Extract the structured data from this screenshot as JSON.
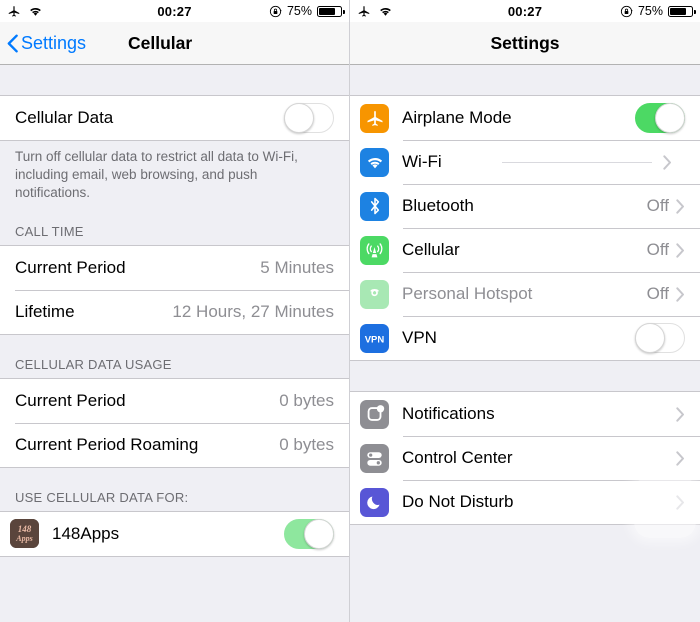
{
  "left": {
    "status_bar": {
      "airplane_icon": "airplane-icon",
      "wifi_icon": "wifi-icon",
      "time": "00:27",
      "rotation_lock_icon": "rotation-lock-icon",
      "battery_percent": "75%",
      "battery_level": 75
    },
    "nav": {
      "back_label": "Settings",
      "title": "Cellular",
      "back_icon": "chevron-left-icon"
    },
    "cellular_data": {
      "label": "Cellular Data",
      "toggle_state": "off",
      "footnote": "Turn off cellular data to restrict all data to Wi-Fi, including email, web browsing, and push notifications."
    },
    "call_time": {
      "header": "CALL TIME",
      "rows": [
        {
          "label": "Current Period",
          "value": "5 Minutes"
        },
        {
          "label": "Lifetime",
          "value": "12 Hours, 27 Minutes"
        }
      ]
    },
    "data_usage": {
      "header": "CELLULAR DATA USAGE",
      "rows": [
        {
          "label": "Current Period",
          "value": "0 bytes"
        },
        {
          "label": "Current Period Roaming",
          "value": "0 bytes"
        }
      ]
    },
    "use_data_for": {
      "header": "USE CELLULAR DATA FOR:",
      "rows": [
        {
          "label": "148Apps",
          "toggle_state": "on",
          "icon": "app-148apps-icon"
        }
      ]
    }
  },
  "right": {
    "status_bar": {
      "airplane_icon": "airplane-icon",
      "wifi_icon": "wifi-icon",
      "time": "00:27",
      "rotation_lock_icon": "rotation-lock-icon",
      "battery_percent": "75%",
      "battery_level": 75
    },
    "nav": {
      "title": "Settings"
    },
    "group_one": [
      {
        "label": "Airplane Mode",
        "icon": "airplane-icon",
        "icon_color": "#f79500",
        "control": "toggle",
        "toggle_state": "on",
        "value": "",
        "disabled": false
      },
      {
        "label": "Wi-Fi",
        "icon": "wifi-icon",
        "icon_color": "#1d82e2",
        "control": "chevron",
        "value": "",
        "dash": true,
        "disabled": false
      },
      {
        "label": "Bluetooth",
        "icon": "bluetooth-icon",
        "icon_color": "#1d82e2",
        "control": "chevron",
        "value": "Off",
        "disabled": false
      },
      {
        "label": "Cellular",
        "icon": "cellular-antenna-icon",
        "icon_color": "#4cd964",
        "control": "chevron",
        "value": "Off",
        "disabled": false
      },
      {
        "label": "Personal Hotspot",
        "icon": "personal-hotspot-icon",
        "icon_color": "#a8e8b4",
        "control": "chevron",
        "value": "Off",
        "disabled": true
      },
      {
        "label": "VPN",
        "icon": "vpn-icon",
        "icon_color": "#1d6fe0",
        "control": "toggle",
        "toggle_state": "off",
        "value": "",
        "disabled": false
      }
    ],
    "group_two": [
      {
        "label": "Notifications",
        "icon": "notifications-icon",
        "icon_color": "#8e8e93",
        "control": "chevron",
        "value": ""
      },
      {
        "label": "Control Center",
        "icon": "control-center-icon",
        "icon_color": "#8e8e93",
        "control": "chevron",
        "value": ""
      },
      {
        "label": "Do Not Disturb",
        "icon": "do-not-disturb-moon-icon",
        "icon_color": "#5856d6",
        "control": "chevron",
        "value": ""
      }
    ]
  },
  "colors": {
    "accent_blue": "#007aff",
    "toggle_green": "#4cd964",
    "separator": "#c8c7cc",
    "group_bg": "#ffffff",
    "page_bg": "#efeff4",
    "secondary_text": "#8e8e93",
    "header_text": "#6d6d72"
  }
}
